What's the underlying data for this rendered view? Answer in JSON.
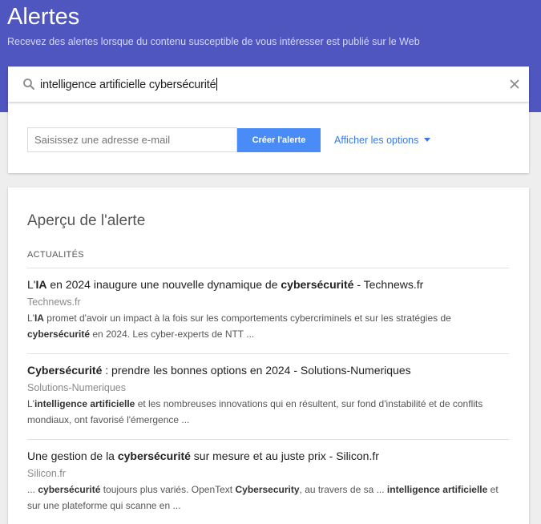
{
  "header": {
    "title": "Alertes",
    "subtitle": "Recevez des alertes lorsque du contenu susceptible de vous intéresser est publié sur le Web"
  },
  "search": {
    "query": "intelligence artificielle cybersécurité",
    "icon": "search-icon",
    "clear_icon": "close-icon"
  },
  "form": {
    "email_placeholder": "Saisissez une adresse e-mail",
    "create_button": "Créer l'alerte",
    "options_link": "Afficher les options"
  },
  "preview": {
    "title": "Aperçu de l'alerte",
    "section": "ACTUALITÉS",
    "results": [
      {
        "title": [
          {
            "t": "L'",
            "b": false
          },
          {
            "t": "IA",
            "b": true
          },
          {
            "t": " en 2024 inaugure une nouvelle dynamique de ",
            "b": false
          },
          {
            "t": "cybersécurité",
            "b": true
          },
          {
            "t": " - Technews.fr",
            "b": false
          }
        ],
        "source": "Technews.fr",
        "snippet": [
          {
            "t": "L'",
            "b": false
          },
          {
            "t": "IA",
            "b": true
          },
          {
            "t": " promet d'avoir un impact à la fois sur les comportements cybercriminels et sur les stratégies de ",
            "b": false
          },
          {
            "t": "cybersécurité",
            "b": true
          },
          {
            "t": " en 2024. Les cyber-experts de NTT ...",
            "b": false
          }
        ]
      },
      {
        "title": [
          {
            "t": "Cybersécurité",
            "b": true
          },
          {
            "t": " : prendre les bonnes options en 2024 - Solutions-Numeriques",
            "b": false
          }
        ],
        "source": "Solutions-Numeriques",
        "snippet": [
          {
            "t": "L'",
            "b": false
          },
          {
            "t": "intelligence artificielle",
            "b": true
          },
          {
            "t": " et les nombreuses innovations qui en résultent, sur fond d'instabilité et de conflits mondiaux, ont favorisé l'émergence ...",
            "b": false
          }
        ]
      },
      {
        "title": [
          {
            "t": "Une gestion de la ",
            "b": false
          },
          {
            "t": "cybersécurité",
            "b": true
          },
          {
            "t": " sur mesure et au juste prix - Silicon.fr",
            "b": false
          }
        ],
        "source": "Silicon.fr",
        "snippet": [
          {
            "t": "... ",
            "b": false
          },
          {
            "t": "cybersécurité",
            "b": true
          },
          {
            "t": " toujours plus variés. OpenText ",
            "b": false
          },
          {
            "t": "Cybersecurity",
            "b": true
          },
          {
            "t": ", au travers de sa ... ",
            "b": false
          },
          {
            "t": "intelligence artificielle",
            "b": true
          },
          {
            "t": " et sur une plateforme qui scanne en ...",
            "b": false
          }
        ]
      }
    ]
  },
  "colors": {
    "header_bg": "#5056bf",
    "button_bg": "#4a8cf7",
    "link": "#3b78e7"
  }
}
